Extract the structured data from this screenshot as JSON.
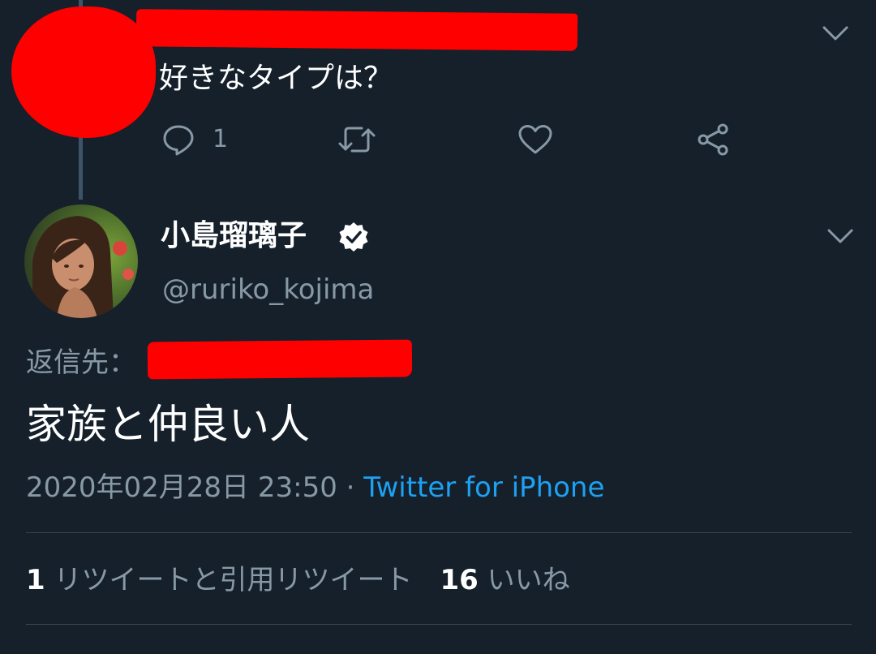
{
  "parent_tweet": {
    "text": "好きなタイプは？",
    "reply_count": "1",
    "icons": [
      "reply-icon",
      "retweet-icon",
      "like-icon",
      "share-icon",
      "chevron-down-icon"
    ]
  },
  "tweet": {
    "display_name": "小島瑠璃子",
    "handle": "@ruriko_kojima",
    "reply_to_label": "返信先：",
    "text": "家族と仲良い人",
    "timestamp": "2020年02月28日 23:50",
    "separator": " · ",
    "source": "Twitter for iPhone",
    "retweet_count": "1",
    "retweet_label": "リツイートと引用リツイート",
    "like_count": "16",
    "like_label": "いいね"
  },
  "colors": {
    "background": "#15202b",
    "secondary_text": "#8899a6",
    "link": "#1da1f2",
    "divider": "#38444d",
    "redaction": "#ff0000"
  }
}
